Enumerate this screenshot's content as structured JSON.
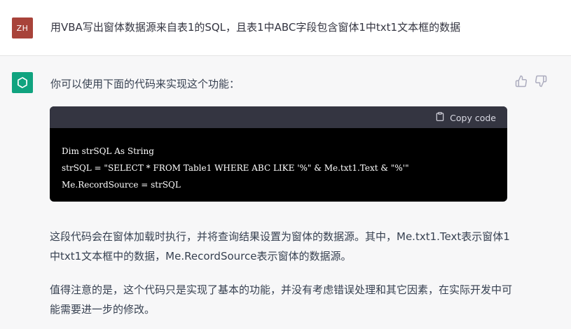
{
  "user": {
    "avatar_initials": "ZH",
    "avatar_color": "#a8433a",
    "message": "用VBA写出窗体数据源来自表1的SQL，且表1中ABC字段包含窗体1中txt1文本框的数据"
  },
  "assistant": {
    "avatar_icon": "openai-logo-icon",
    "avatar_color": "#10a37f",
    "intro": "你可以使用下面的代码来实现这个功能：",
    "feedback": {
      "like_icon": "thumbs-up-icon",
      "dislike_icon": "thumbs-down-icon"
    },
    "code": {
      "copy_label": "Copy code",
      "copy_icon": "clipboard-icon",
      "lines": [
        "Dim strSQL As String",
        "strSQL = \"SELECT * FROM Table1 WHERE ABC LIKE '%\" & Me.txt1.Text & \"%'\"",
        "Me.RecordSource = strSQL"
      ]
    },
    "paragraphs": [
      "这段代码会在窗体加载时执行，并将查询结果设置为窗体的数据源。其中，Me.txt1.Text表示窗体1中txt1文本框中的数据，Me.RecordSource表示窗体的数据源。",
      "值得注意的是，这个代码只是实现了基本的功能，并没有考虑错误处理和其它因素，在实际开发中可能需要进一步的修改。"
    ]
  }
}
